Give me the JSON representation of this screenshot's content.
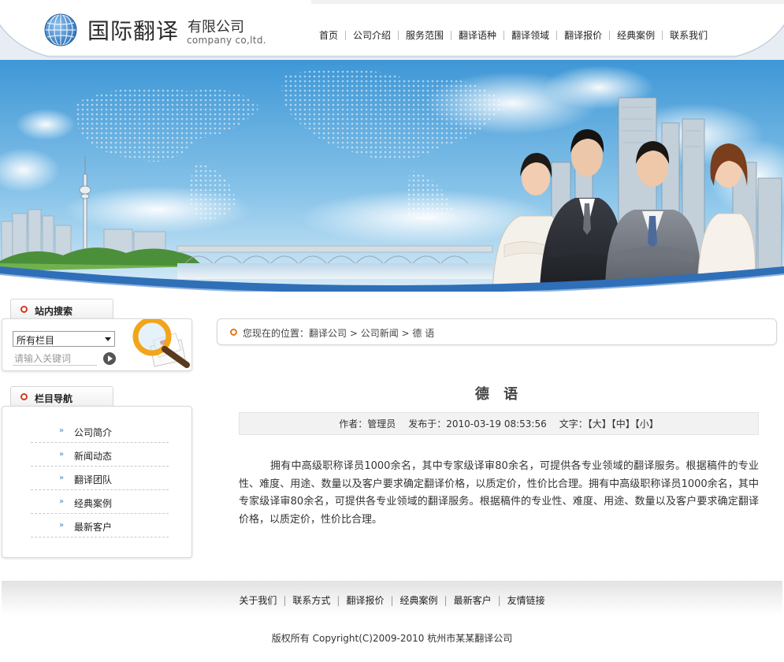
{
  "header": {
    "logo_cn": "国际翻译",
    "logo_sub": "有限公司",
    "logo_en": "company co,ltd.",
    "nav": [
      "首页",
      "公司介绍",
      "服务范围",
      "翻译语种",
      "翻译领域",
      "翻译报价",
      "经典案例",
      "联系我们"
    ]
  },
  "sidebar": {
    "search": {
      "title": "站内搜索",
      "select_value": "所有栏目",
      "placeholder": "请输入关键词"
    },
    "nav": {
      "title": "栏目导航",
      "items": [
        "公司简介",
        "新闻动态",
        "翻译团队",
        "经典案例",
        "最新客户"
      ]
    }
  },
  "breadcrumb": {
    "prefix": "您现在的位置：",
    "items": [
      "翻译公司",
      "公司新闻",
      "德 语"
    ]
  },
  "article": {
    "title": "德 语",
    "author_label": "作者：",
    "author": "管理员",
    "date_label": "发布于：",
    "date": "2010-03-19 08:53:56",
    "size_label": "文字：",
    "sizes": [
      "【大】",
      "【中】",
      "【小】"
    ],
    "body": "拥有中高级职称译员1000余名，其中专家级译审80余名，可提供各专业领域的翻译服务。根据稿件的专业性、难度、用途、数量以及客户要求确定翻译价格，以质定价，性价比合理。拥有中高级职称译员1000余名，其中专家级译审80余名，可提供各专业领域的翻译服务。根据稿件的专业性、难度、用途、数量以及客户要求确定翻译价格，以质定价，性价比合理。"
  },
  "footer": {
    "links": [
      "关于我们",
      "联系方式",
      "翻译报价",
      "经典案例",
      "最新客户",
      "友情链接"
    ],
    "copyright": "版权所有  Copyright(C)2009-2010 杭州市某某翻译公司"
  },
  "colors": {
    "accent_red": "#d23a1f",
    "accent_orange": "#e07a1c",
    "sky_blue": "#4aa3dc",
    "banner_arc": "#2f6fb8"
  }
}
